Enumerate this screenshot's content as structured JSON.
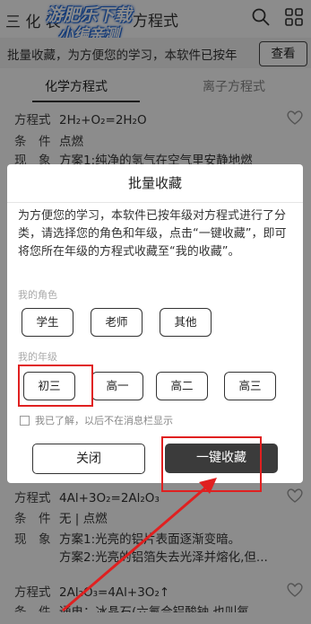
{
  "header": {
    "menu_label": "三 化 表",
    "title": "方程式",
    "watermark_line1": "游肥乐下载",
    "watermark_line2": "小编亲测"
  },
  "notice": {
    "text": "批量收藏，为方便您的学习，本软件已按年",
    "button": "查看"
  },
  "tabs": [
    {
      "label": "化学方程式",
      "active": true
    },
    {
      "label": "离子方程式",
      "active": false
    }
  ],
  "entries": [
    {
      "equation_label": "方程式",
      "equation": "2H₂+O₂=2H₂O",
      "condition_label": "条　件",
      "condition": "点燃",
      "phenomenon_label": "现　象",
      "phenomenon": "方案1:纯净的氢气在空气里安静地燃"
    },
    {
      "equation_label": "方程式",
      "equation": "4Al+3O₂=2Al₂O₃",
      "condition_label": "条　件",
      "condition": "无 | 点燃",
      "phenomenon_label": "现　象",
      "phenomenon": "方案1:光亮的铝片表面逐渐变暗。",
      "phenomenon2": "方案2:光亮的铝箔失去光泽并熔化,但..."
    },
    {
      "equation_label": "方程式",
      "equation": "2Al₂O₃=4Al+3O₂↑",
      "condition_label": "条　件",
      "condition": "通电；冰晶石(六氟合铝酸钠,也叫氧"
    }
  ],
  "dialog": {
    "title": "批量收藏",
    "description": "为方便您的学习，本软件已按年级对方程式进行了分类，请选择您的角色和年级，点击“一键收藏”，即可将您所在年级的方程式收藏至“我的收藏”。",
    "role_label": "我的角色",
    "roles": [
      "学生",
      "老师",
      "其他"
    ],
    "grade_label": "我的年级",
    "grades": [
      "初三",
      "高一",
      "高二",
      "高三"
    ],
    "checkbox_text": "我已了解，以后不在消息栏显示",
    "close_button": "关闭",
    "collect_button": "一键收藏"
  },
  "colors": {
    "overlay": "rgba(0,0,0,0.45)",
    "highlight": "#e02020",
    "primary_button": "#3b3b3b",
    "watermark": "#1e66d8"
  },
  "icons": [
    "menu-icon",
    "search-icon",
    "grid-icon",
    "heart-icon",
    "arrow-icon"
  ]
}
